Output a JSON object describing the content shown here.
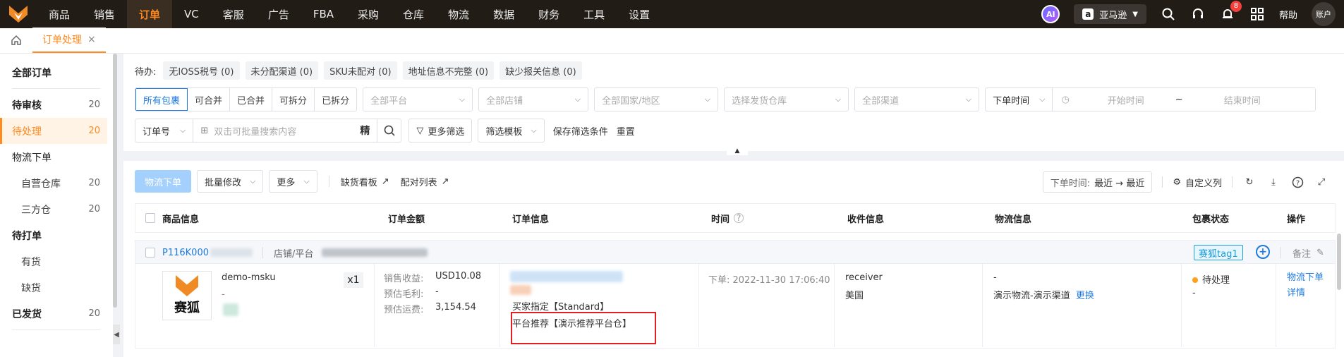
{
  "topnav": {
    "items": [
      "商品",
      "销售",
      "订单",
      "VC",
      "客服",
      "广告",
      "FBA",
      "采购",
      "仓库",
      "物流",
      "数据",
      "财务",
      "工具",
      "设置"
    ],
    "active_index": 2,
    "ai_label": "AI",
    "store_label": "亚马逊",
    "notif_count": "8",
    "help_label": "帮助",
    "account_label": "账户"
  },
  "tabs": {
    "active_label": "订单处理",
    "close_glyph": "×"
  },
  "sidebar": {
    "all_orders": "全部订单",
    "items": [
      {
        "label": "待审核",
        "count": "20"
      },
      {
        "label": "待处理",
        "count": "20"
      },
      {
        "label": "物流下单",
        "count": ""
      },
      {
        "label": "自营仓库",
        "count": "20"
      },
      {
        "label": "三方仓",
        "count": "20"
      },
      {
        "label": "待打单",
        "count": ""
      },
      {
        "label": "有货",
        "count": ""
      },
      {
        "label": "缺货",
        "count": ""
      },
      {
        "label": "已发货",
        "count": "20"
      }
    ]
  },
  "filters": {
    "todo_label": "待办:",
    "todo_chips": [
      "无IOSS税号 (0)",
      "未分配渠道 (0)",
      "SKU未配对 (0)",
      "地址信息不完整 (0)",
      "缺少报关信息 (0)"
    ],
    "package_segments": [
      "所有包裹",
      "可合并",
      "已合并",
      "可拆分",
      "已拆分"
    ],
    "platform_placeholder": "全部平台",
    "store_placeholder": "全部店铺",
    "country_placeholder": "全部国家/地区",
    "warehouse_placeholder": "选择发货仓库",
    "channel_placeholder": "全部渠道",
    "date_type": "下单时间",
    "start_placeholder": "开始时间",
    "range_sep": "~",
    "end_placeholder": "结束时间",
    "search_type": "订单号",
    "search_placeholder": "双击可批量搜索内容",
    "exact_label": "精",
    "more_filters": "更多筛选",
    "filter_template": "筛选模板",
    "save_filter": "保存筛选条件",
    "reset": "重置"
  },
  "actions": {
    "logistics_order": "物流下单",
    "batch_edit": "批量修改",
    "more": "更多",
    "shortage_board": "缺货看板",
    "pair_list": "配对列表",
    "sort_label": "下单时间:",
    "sort_value": "最近 → 最近",
    "custom_columns": "自定义列"
  },
  "table": {
    "headers": [
      "商品信息",
      "订单金额",
      "订单信息",
      "时间",
      "收件信息",
      "物流信息",
      "包裹状态",
      "操作"
    ]
  },
  "order": {
    "order_no_prefix": "P116K000",
    "store_label": "店铺/平台",
    "tag": "赛狐tag1",
    "remark": "备注",
    "product_brand": "赛狐",
    "msku": "demo-msku",
    "dash": "-",
    "qty": "x1",
    "sales_label": "销售收益:",
    "sales_value": "USD10.08",
    "gross_label": "预估毛利:",
    "gross_value": "-",
    "freight_label": "预估运费:",
    "freight_value": "3,154.54",
    "buyer_specified": "买家指定【Standard】",
    "platform_recommend": "平台推荐【演示推荐平台仓】",
    "order_time": "下单: 2022-11-30 17:06:40",
    "receiver": "receiver",
    "country": "美国",
    "logistics_dash": "-",
    "logistics_channel": "演示物流-演示渠道",
    "change_link": "更换",
    "status": "待处理",
    "status_dash": "-",
    "op_logistics": "物流下单",
    "op_detail": "详情"
  }
}
